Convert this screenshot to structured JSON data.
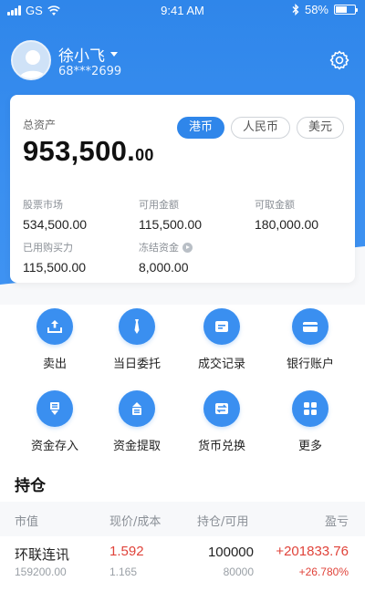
{
  "status_bar": {
    "carrier": "GS",
    "time": "9:41 AM",
    "battery": "58%",
    "battery_level": 0.58
  },
  "profile": {
    "name": "徐小飞",
    "account": "68***2699"
  },
  "summary": {
    "label": "总资产",
    "value_main": "953,500.",
    "value_decimal": "00",
    "currency_tabs": [
      "港币",
      "人民币",
      "美元"
    ],
    "active_currency": "港币",
    "metrics": [
      {
        "label": "股票市场",
        "value": "534,500.00"
      },
      {
        "label": "可用金额",
        "value": "115,500.00"
      },
      {
        "label": "可取金额",
        "value": "180,000.00"
      },
      {
        "label": "已用购买力",
        "value": "115,500.00"
      },
      {
        "label": "冻结资金",
        "value": "8,000.00"
      }
    ]
  },
  "actions": [
    {
      "label": "卖出",
      "icon": "upload-tray-icon"
    },
    {
      "label": "当日委托",
      "icon": "tie-icon"
    },
    {
      "label": "成交记录",
      "icon": "document-icon"
    },
    {
      "label": "银行账户",
      "icon": "bank-card-icon"
    },
    {
      "label": "资金存入",
      "icon": "deposit-arrow-icon"
    },
    {
      "label": "资金提取",
      "icon": "withdraw-arrow-icon"
    },
    {
      "label": "货币兑换",
      "icon": "exchange-icon"
    },
    {
      "label": "更多",
      "icon": "more-grid-icon"
    }
  ],
  "holdings": {
    "title": "持仓",
    "columns": [
      "市值",
      "现价/成本",
      "持仓/可用",
      "盈亏"
    ],
    "rows": [
      {
        "name": "环联连讯",
        "market_value": "159200.00",
        "price": "1.592",
        "cost": "1.165",
        "position": "100000",
        "available": "80000",
        "pnl": "+201833.76",
        "pnl_pct": "+26.780%"
      }
    ]
  },
  "colors": {
    "primary": "#2f86ea",
    "up": "#e0433a",
    "text": "#222222",
    "muted": "#8a8f96"
  }
}
